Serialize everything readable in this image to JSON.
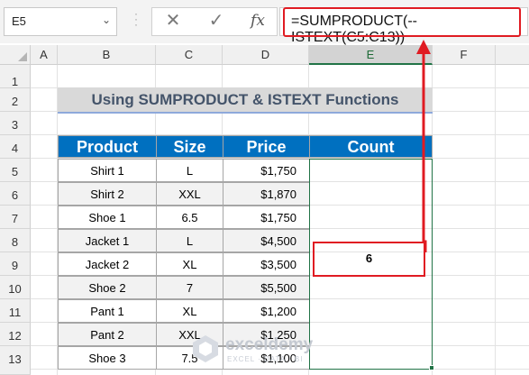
{
  "formula_bar": {
    "name_box": "E5",
    "name_box_dropdown": "⌄",
    "cancel_symbol": "✕",
    "enter_symbol": "✓",
    "fx_label": "fx",
    "formula": "=SUMPRODUCT(--ISTEXT(C5:C13))"
  },
  "columns": [
    "A",
    "B",
    "C",
    "D",
    "E",
    "F"
  ],
  "selected_column": "E",
  "rows": [
    "1",
    "2",
    "3",
    "4",
    "5",
    "6",
    "7",
    "8",
    "9",
    "10",
    "11",
    "12",
    "13"
  ],
  "title": "Using SUMPRODUCT & ISTEXT Functions",
  "table": {
    "headers": [
      "Product",
      "Size",
      "Price",
      "Count"
    ],
    "rows": [
      {
        "product": "Shirt 1",
        "size": "L",
        "price": "$1,750"
      },
      {
        "product": "Shirt 2",
        "size": "XXL",
        "price": "$1,870"
      },
      {
        "product": "Shoe 1",
        "size": "6.5",
        "price": "$1,750"
      },
      {
        "product": "Jacket 1",
        "size": "L",
        "price": "$4,500"
      },
      {
        "product": "Jacket 2",
        "size": "XL",
        "price": "$3,500"
      },
      {
        "product": "Shoe 2",
        "size": "7",
        "price": "$5,500"
      },
      {
        "product": "Pant 1",
        "size": "XL",
        "price": "$1,200"
      },
      {
        "product": "Pant 2",
        "size": "XXL",
        "price": "$1,250"
      },
      {
        "product": "Shoe 3",
        "size": "7.5",
        "price": "$1,100"
      }
    ],
    "count_result": "6"
  },
  "watermark": {
    "brand": "exceldemy",
    "tagline": "EXCEL · DATA · BI"
  },
  "colors": {
    "header_blue": "#0070c0",
    "highlight_red": "#e01b22",
    "selection_green": "#217346"
  }
}
